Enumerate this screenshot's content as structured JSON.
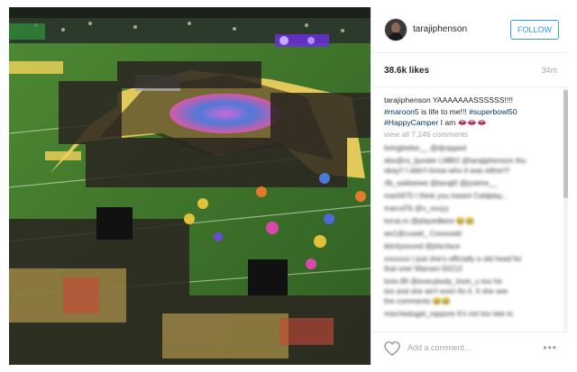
{
  "post": {
    "username": "tarajiphenson",
    "follow_label": "FOLLOW",
    "likes": "38.6k likes",
    "time": "34m",
    "caption": {
      "user": "tarajiphenson",
      "text_1": " YAAAAAAASSSSSS!!!!",
      "tag_1": "#maroon5",
      "text_2": " is life to me!!! ",
      "tag_2": "#superbowl50",
      "tag_3": "#HappyCamper",
      "text_3": " I am ",
      "emoji": "👄👄👄"
    },
    "view_all": "view all 7,146 comments",
    "add_comment_placeholder": "Add a comment...",
    "more_label": "•••"
  },
  "blurred_comments": [
    "livingbetter__ @djrapped",
    "ebs@ro_tjunder LMBO @tarajiphenson thu",
    "okay!! I didn't know who it was either!!!",
    "rfb_wallstreet @taraji0 @justme__",
    "mar0470 I think you meant Coldplay...",
    "marcd7b @x_xxxyy",
    "lorrai.m @playedbest 😂😂",
    "ws1@cuseil_ Cooooold",
    "bitcitysound @jrlecface",
    "xxxxxxx I just she's officially a old head for",
    "that one! Maroon 50212",
    "lorie.89 @everybody_lovin_u too he",
    "too and she ain't even fin it. It she see",
    "the comments 😂😂",
    "mischedugel_rappore It's not too late to"
  ],
  "icons": {
    "heart": "heart-icon",
    "more": "more-options-icon",
    "avatar": "profile-avatar"
  }
}
